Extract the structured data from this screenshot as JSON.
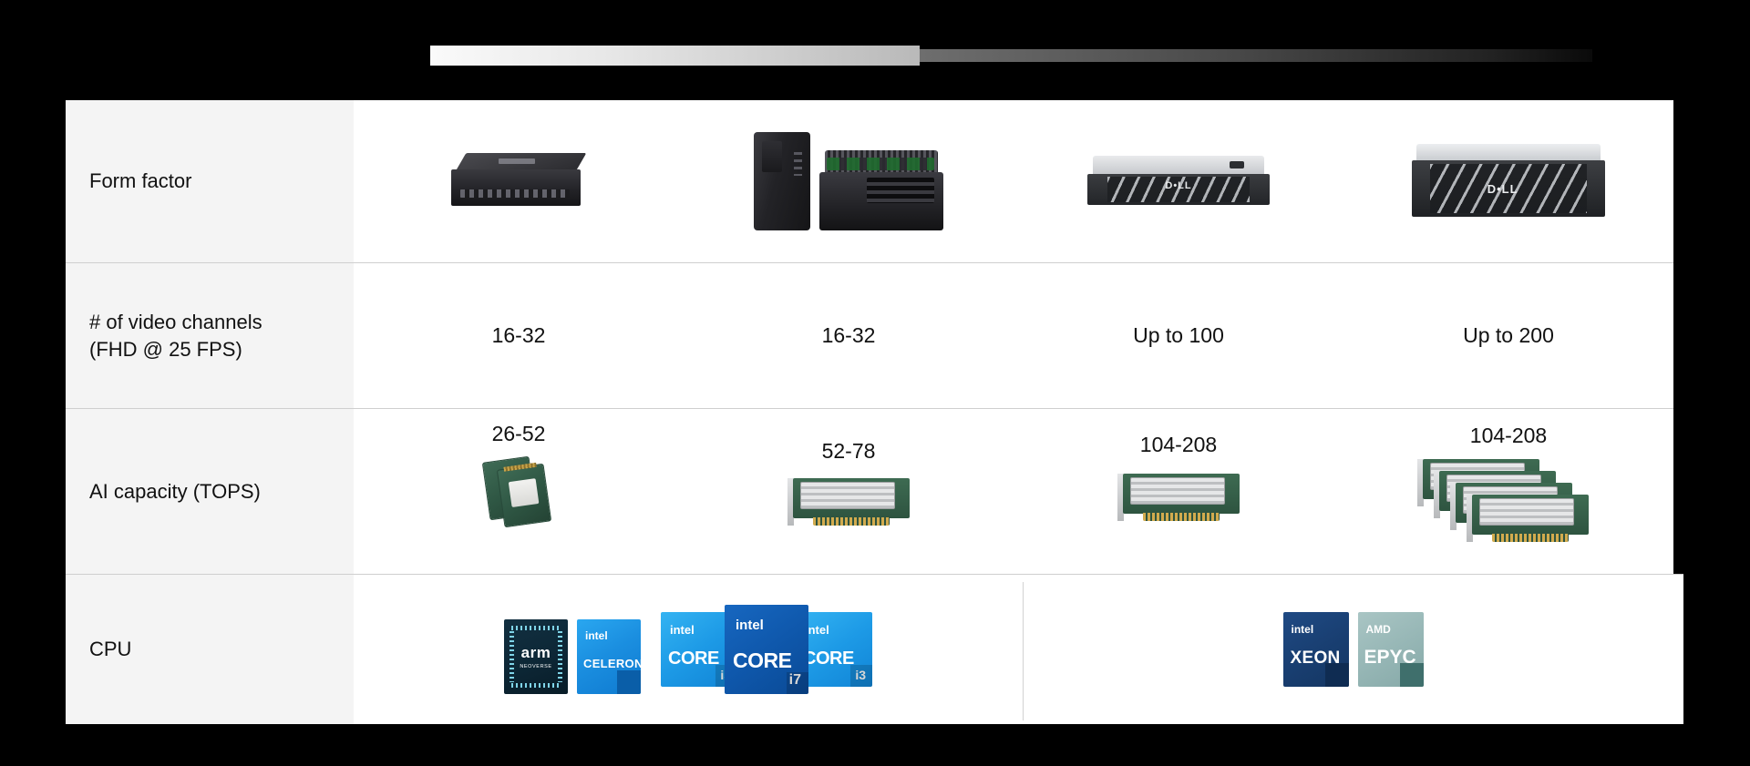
{
  "top_bar": {
    "fill_color": "#e8e8e8",
    "track_color": "#3a3a3a"
  },
  "table": {
    "rows": [
      {
        "label": "Form factor",
        "cells": [
          {
            "value": "",
            "art": "edge-appliance"
          },
          {
            "value": "",
            "art": "tower-and-rugged-pc"
          },
          {
            "value": "",
            "art": "dell-1u-rack-server"
          },
          {
            "value": "",
            "art": "dell-2u-rack-server"
          }
        ]
      },
      {
        "label": "# of video channels\n(FHD @ 25 FPS)",
        "cells": [
          {
            "value": "16-32"
          },
          {
            "value": "16-32"
          },
          {
            "value": "Up to 100"
          },
          {
            "value": "Up to 200"
          }
        ]
      },
      {
        "label": "AI capacity (TOPS)",
        "cells": [
          {
            "value": "26-52",
            "art": "m2-ai-module"
          },
          {
            "value": "52-78",
            "art": "pcie-accelerator-card"
          },
          {
            "value": "104-208",
            "art": "pcie-accelerator-card"
          },
          {
            "value": "104-208",
            "art": "pcie-accelerator-card-stack"
          }
        ]
      },
      {
        "label": "CPU",
        "cpu_left": [
          {
            "brand": "arm",
            "name": "arm",
            "sub": "NEOVERSE",
            "color": "#0d2736"
          },
          {
            "brand": "intel",
            "name": "CELERON",
            "sku": "",
            "color": "#1b8fe0"
          },
          {
            "brand": "intel",
            "name": "CORE",
            "sku": "i5",
            "color": "#1d9ae6"
          },
          {
            "brand": "intel",
            "name": "CORE",
            "sku": "i7",
            "color": "#0f58ac"
          },
          {
            "brand": "intel",
            "name": "CORE",
            "sku": "i3",
            "color": "#1d9ae6"
          }
        ],
        "cpu_right": [
          {
            "brand": "intel",
            "name": "XEON",
            "color": "#193f72"
          },
          {
            "brand": "AMD",
            "name": "EPYC",
            "color": "#97b7b6"
          }
        ]
      }
    ]
  }
}
